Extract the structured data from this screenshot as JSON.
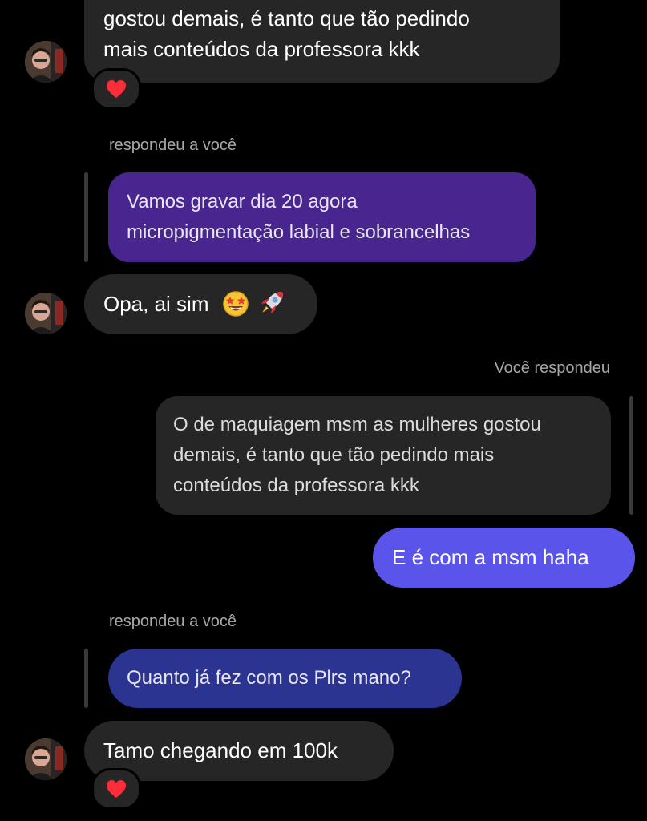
{
  "thread": {
    "msg1": {
      "text_line1": "gostou demais, é tanto que tão pedindo",
      "text_line2": "mais conteúdos da professora kkk",
      "reaction": "heart"
    },
    "reply1": {
      "label": "respondeu a você",
      "quote_line1": "Vamos gravar dia 20 agora",
      "quote_line2": "micropigmentação labial e sobrancelhas"
    },
    "msg2": {
      "text": "Opa, ai sim",
      "emojis": [
        "star-struck-emoji",
        "rocket-emoji"
      ]
    },
    "reply2": {
      "label": "Você respondeu",
      "quote_line1": "O de maquiagem msm as mulheres gostou",
      "quote_line2": "demais, é tanto que tão pedindo mais",
      "quote_line3": "conteúdos da professora kkk"
    },
    "msg3": {
      "text": "E é com a msm haha"
    },
    "reply3": {
      "label": "respondeu a você",
      "quote": "Quanto já fez com os Plrs mano?"
    },
    "msg4": {
      "text": "Tamo chegando em 100k",
      "reaction": "heart"
    }
  },
  "colors": {
    "background": "#000000",
    "received_bubble": "#262626",
    "sent_bubble": "#5b54ea",
    "reply_quote_purple": "#48258f",
    "reply_quote_blue": "#2c3491",
    "secondary_text": "#a8a8a8"
  }
}
